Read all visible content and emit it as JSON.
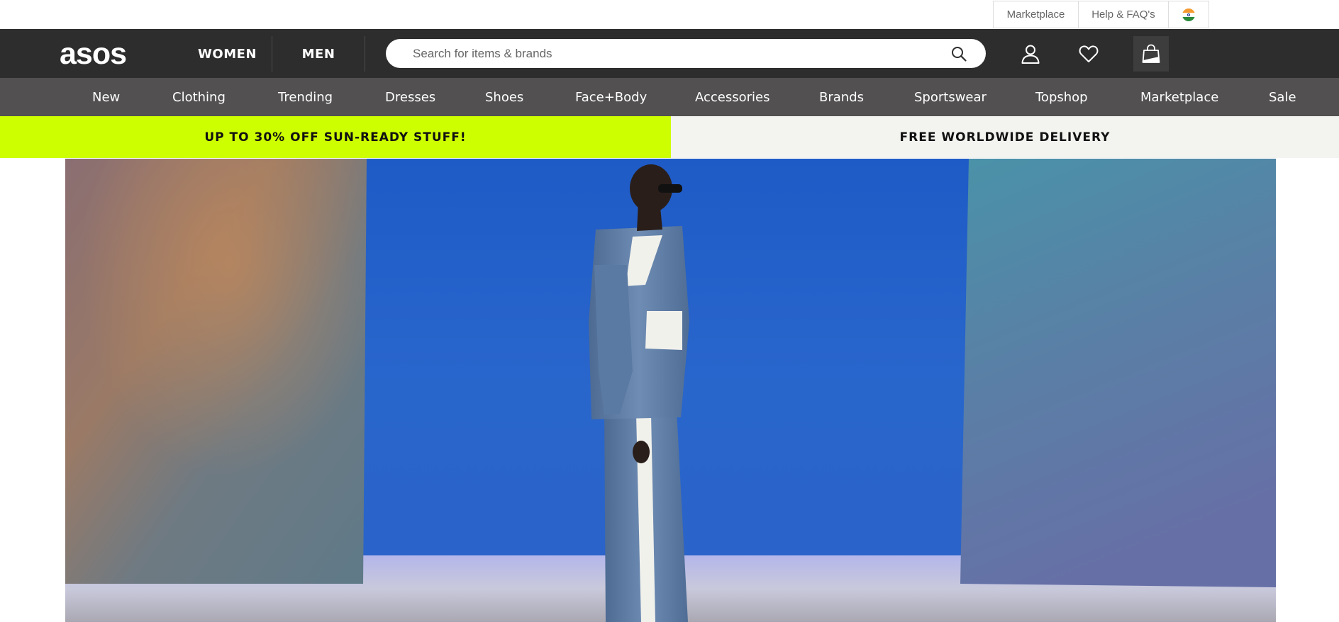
{
  "utility": {
    "marketplace": "Marketplace",
    "help": "Help & FAQ's",
    "country_icon": "india-flag-icon"
  },
  "header": {
    "logo": "asos",
    "tabs": [
      "WOMEN",
      "MEN"
    ],
    "search_placeholder": "Search for items & brands",
    "icons": [
      "search-icon",
      "account-icon",
      "heart-icon",
      "bag-icon"
    ]
  },
  "nav": {
    "items": [
      "New",
      "Clothing",
      "Trending",
      "Dresses",
      "Shoes",
      "Face+Body",
      "Accessories",
      "Brands",
      "Sportswear",
      "Topshop",
      "Marketplace",
      "Sale"
    ]
  },
  "promo": {
    "left": "UP TO 30% OFF SUN-READY STUFF!",
    "right": "FREE WORLDWIDE DELIVERY"
  },
  "colors": {
    "header_bg": "#2d2d2d",
    "nav_bg": "#525050",
    "promo_lime": "#cdff00",
    "promo_light": "#f3f3f0",
    "hero_blue": "#2460c4"
  }
}
